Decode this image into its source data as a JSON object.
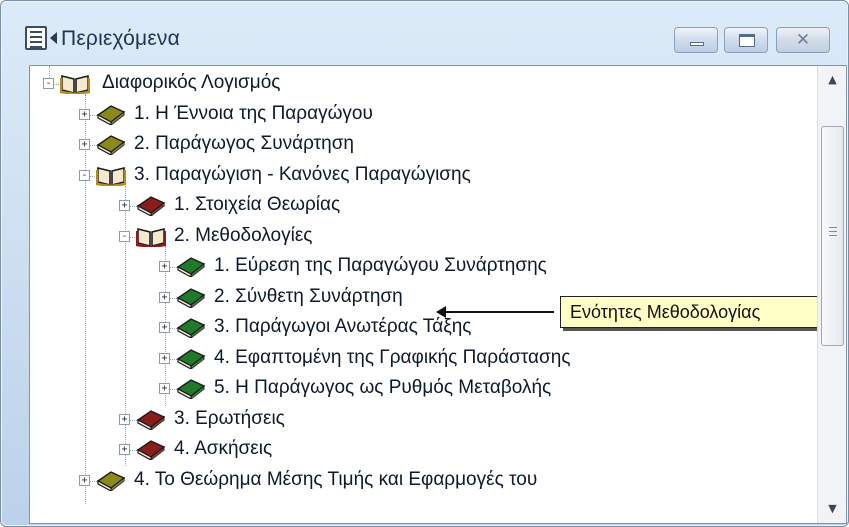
{
  "window": {
    "title": "Περιεχόμενα",
    "icon": "contents-list-icon",
    "buttons": {
      "minimize": "minimize-icon",
      "maximize": "maximize-icon",
      "close": "close-icon"
    }
  },
  "tree": [
    {
      "label": "Διαφορικός Λογισμός",
      "state": "-",
      "book": "open",
      "color": "#b58a1e"
    },
    {
      "label": "1.  Η Έννοια της Παραγώγου",
      "state": "+",
      "book": "closed",
      "color": "#8a8a1a"
    },
    {
      "label": "2.  Παράγωγος Συνάρτηση",
      "state": "+",
      "book": "closed",
      "color": "#8a8a1a"
    },
    {
      "label": "3.  Παραγώγιση - Κανόνες Παραγώγισης",
      "state": "-",
      "book": "open",
      "color": "#b58a1e"
    },
    {
      "label": "1.  Στοιχεία Θεωρίας",
      "state": "+",
      "book": "closed",
      "color": "#8b1c1c"
    },
    {
      "label": "2.  Μεθοδολογίες",
      "state": "-",
      "book": "open",
      "color": "#8b1c1c"
    },
    {
      "label": "1.  Εύρεση της Παραγώγου Συνάρτησης",
      "state": "+",
      "book": "closed",
      "color": "#1f7a2a"
    },
    {
      "label": "2.  Σύνθετη Συνάρτηση",
      "state": "+",
      "book": "closed",
      "color": "#1f7a2a"
    },
    {
      "label": "3.  Παράγωγοι Ανωτέρας Τάξης",
      "state": "+",
      "book": "closed",
      "color": "#1f7a2a"
    },
    {
      "label": "4.  Εφαπτομένη της Γραφικής Παράστασης",
      "state": "+",
      "book": "closed",
      "color": "#1f7a2a"
    },
    {
      "label": "5.  Η Παράγωγος ως Ρυθμός Μεταβολής",
      "state": "+",
      "book": "closed",
      "color": "#1f7a2a"
    },
    {
      "label": "3.  Ερωτήσεις",
      "state": "+",
      "book": "closed",
      "color": "#8b1c1c"
    },
    {
      "label": "4.  Ασκήσεις",
      "state": "+",
      "book": "closed",
      "color": "#8b1c1c"
    },
    {
      "label": "4.  Το Θεώρημα Μέσης Τιμής και Εφαρμογές του",
      "state": "+",
      "book": "closed",
      "color": "#8a8a1a"
    }
  ],
  "callout": {
    "text": "Ενότητες Μεθοδολογίας"
  },
  "scrollbar": {
    "up": "▲",
    "down": "▼"
  }
}
